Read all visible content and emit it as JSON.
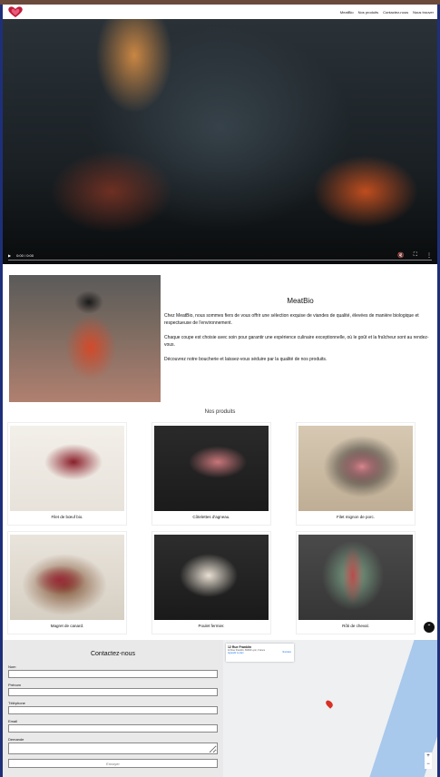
{
  "header": {
    "logo": "heart-logo",
    "nav": [
      "MeatBio",
      "Nos produits",
      "Contactez-nous",
      "Nous trouver"
    ]
  },
  "video": {
    "time": "0:00 / 0:00"
  },
  "about": {
    "title": "MeatBio",
    "paragraphs": [
      "Chez MeatBio, nous sommes fiers de vous offrir une sélection exquise de viandes de qualité, élevées de manière biologique et respectueuse de l'environnement.",
      "Chaque coupe est choisie avec soin pour garantir une expérience culinaire exceptionnelle, où le goût et la fraîcheur sont au rendez-vous.",
      "Découvrez notre boucherie et laissez-vous séduire par la qualité de nos produits."
    ]
  },
  "products": {
    "title": "Nos produits",
    "items": [
      {
        "caption": "Filet de bœuf bio."
      },
      {
        "caption": "Côtelettes d'agneau."
      },
      {
        "caption": "Filet mignon de porc."
      },
      {
        "caption": "Magret de canard."
      },
      {
        "caption": "Poulet fermier."
      },
      {
        "caption": "Rôti de cheval."
      }
    ]
  },
  "contact": {
    "title": "Contactez-nous",
    "fields": [
      "Nom",
      "Prénom",
      "Téléphone",
      "Email",
      "Demande"
    ],
    "submit": "Envoyer"
  },
  "map": {
    "place_title": "12 Rue Franklin",
    "place_address": "12 Rue Franklin, 69002 Lyon, France",
    "directions": "Itinéraire",
    "larger_map": "Agrandir le plan"
  },
  "colors": {
    "brand_stripe": "#6b4a3c",
    "side_stripe": "#1e2f7a",
    "form_bg": "#e9e9e9"
  }
}
